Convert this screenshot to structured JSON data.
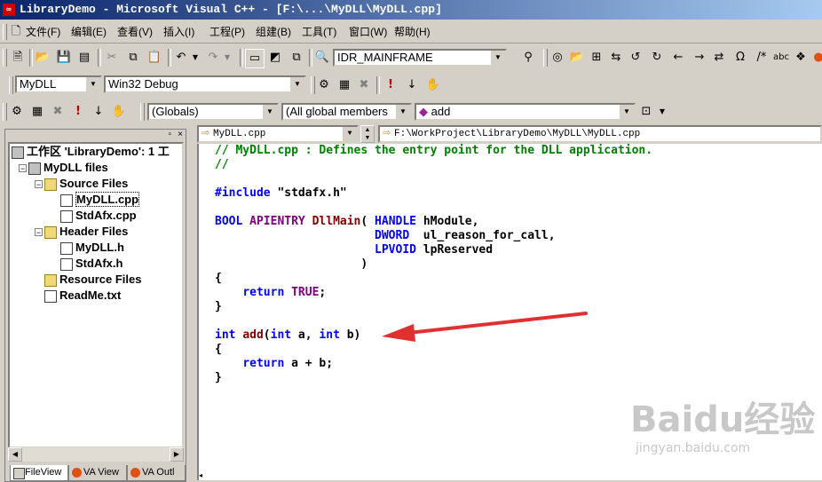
{
  "window": {
    "title": "LibraryDemo - Microsoft Visual C++ - [F:\\...\\MyDLL\\MyDLL.cpp]"
  },
  "menu": [
    "文件(F)",
    "编辑(E)",
    "查看(V)",
    "插入(I)",
    "工程(P)",
    "组建(B)",
    "工具(T)",
    "窗口(W)",
    "帮助(H)"
  ],
  "toolbar": {
    "resource_combo": "IDR_MAINFRAME"
  },
  "build_toolbar": {
    "project_combo": "MyDLL",
    "config_combo": "Win32 Debug"
  },
  "wizardbar": {
    "class_combo": "(Globals)",
    "filter_combo": "(All global members",
    "member_combo": "add"
  },
  "workspace": {
    "root": "工作区 'LibraryDemo': 1 工",
    "project": "MyDLL files",
    "source_folder": "Source Files",
    "source_files": [
      "MyDLL.cpp",
      "StdAfx.cpp"
    ],
    "header_folder": "Header Files",
    "header_files": [
      "MyDLL.h",
      "StdAfx.h"
    ],
    "resource_folder": "Resource Files",
    "readme": "ReadMe.txt",
    "tabs": [
      "FileView",
      "VA View",
      "VA Outl"
    ]
  },
  "editor": {
    "file_combo": "MyDLL.cpp",
    "path": "F:\\WorkProject\\LibraryDemo\\MyDLL\\MyDLL.cpp",
    "code": {
      "l1": "// MyDLL.cpp : Defines the entry point for the DLL application.",
      "l2": "//",
      "l4_kw": "#include",
      "l4_rest": " \"stdafx.h\"",
      "l6_kw1": "BOOL",
      "l6_mac": "APIENTRY",
      "l6_fn": "DllMain",
      "l6_rest1": "( ",
      "l6_kw2": "HANDLE",
      "l6_rest2": " hModule,",
      "l7_kw": "DWORD",
      "l7_rest": "  ul_reason_for_call,",
      "l8_kw": "LPVOID",
      "l8_rest": " lpReserved",
      "l9": ")",
      "l10": "{",
      "l11_kw": "return",
      "l11_mac": "TRUE",
      "l11_rest": ";",
      "l12": "}",
      "l14_kw1": "int",
      "l14_fn": "add",
      "l14_r1": "(",
      "l14_kw2": "int",
      "l14_r2": " a, ",
      "l14_kw3": "int",
      "l14_r3": " b)",
      "l15": "{",
      "l16_kw": "return",
      "l16_rest": " a + b;",
      "l17": "}"
    }
  },
  "watermark": {
    "logo": "Baidu经验",
    "url": "jingyan.baidu.com"
  },
  "colors": {
    "arrow": "#e03030",
    "comment": "#008000",
    "keyword": "#0000ff",
    "macro": "#800080"
  }
}
